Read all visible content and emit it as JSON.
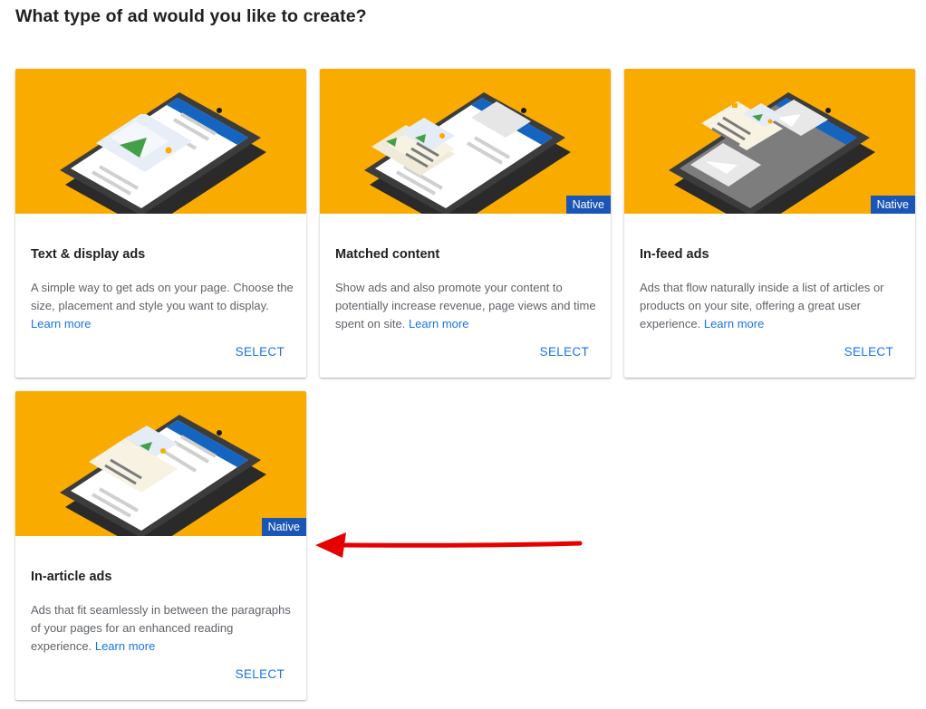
{
  "header": {
    "title": "What type of ad would you like to create?"
  },
  "cards": [
    {
      "title": "Text & display ads",
      "description": "A simple way to get ads on your page. Choose the size, placement and style you want to display.",
      "learn_more": "Learn more",
      "select_label": "SELECT",
      "badge": null,
      "illustration": "phone-display-ad-icon"
    },
    {
      "title": "Matched content",
      "description": "Show ads and also promote your content to potentially increase revenue, page views and time spent on site.",
      "learn_more": "Learn more",
      "select_label": "SELECT",
      "badge": "Native",
      "illustration": "phone-matched-content-icon"
    },
    {
      "title": "In-feed ads",
      "description": "Ads that flow naturally inside a list of articles or products on your site, offering a great user experience.",
      "learn_more": "Learn more",
      "select_label": "SELECT",
      "badge": "Native",
      "illustration": "phone-in-feed-icon"
    },
    {
      "title": "In-article ads",
      "description": "Ads that fit seamlessly in between the paragraphs of your pages for an enhanced reading experience.",
      "learn_more": "Learn more",
      "select_label": "SELECT",
      "badge": "Native",
      "illustration": "phone-in-article-icon"
    }
  ],
  "annotation": {
    "type": "arrow",
    "color": "#e60000",
    "points_to": "In-article ads"
  },
  "colors": {
    "banner": "#f9ab00",
    "badge": "#1a56b6",
    "link": "#1a73e8",
    "text": "#212121",
    "muted": "#5f6368"
  }
}
